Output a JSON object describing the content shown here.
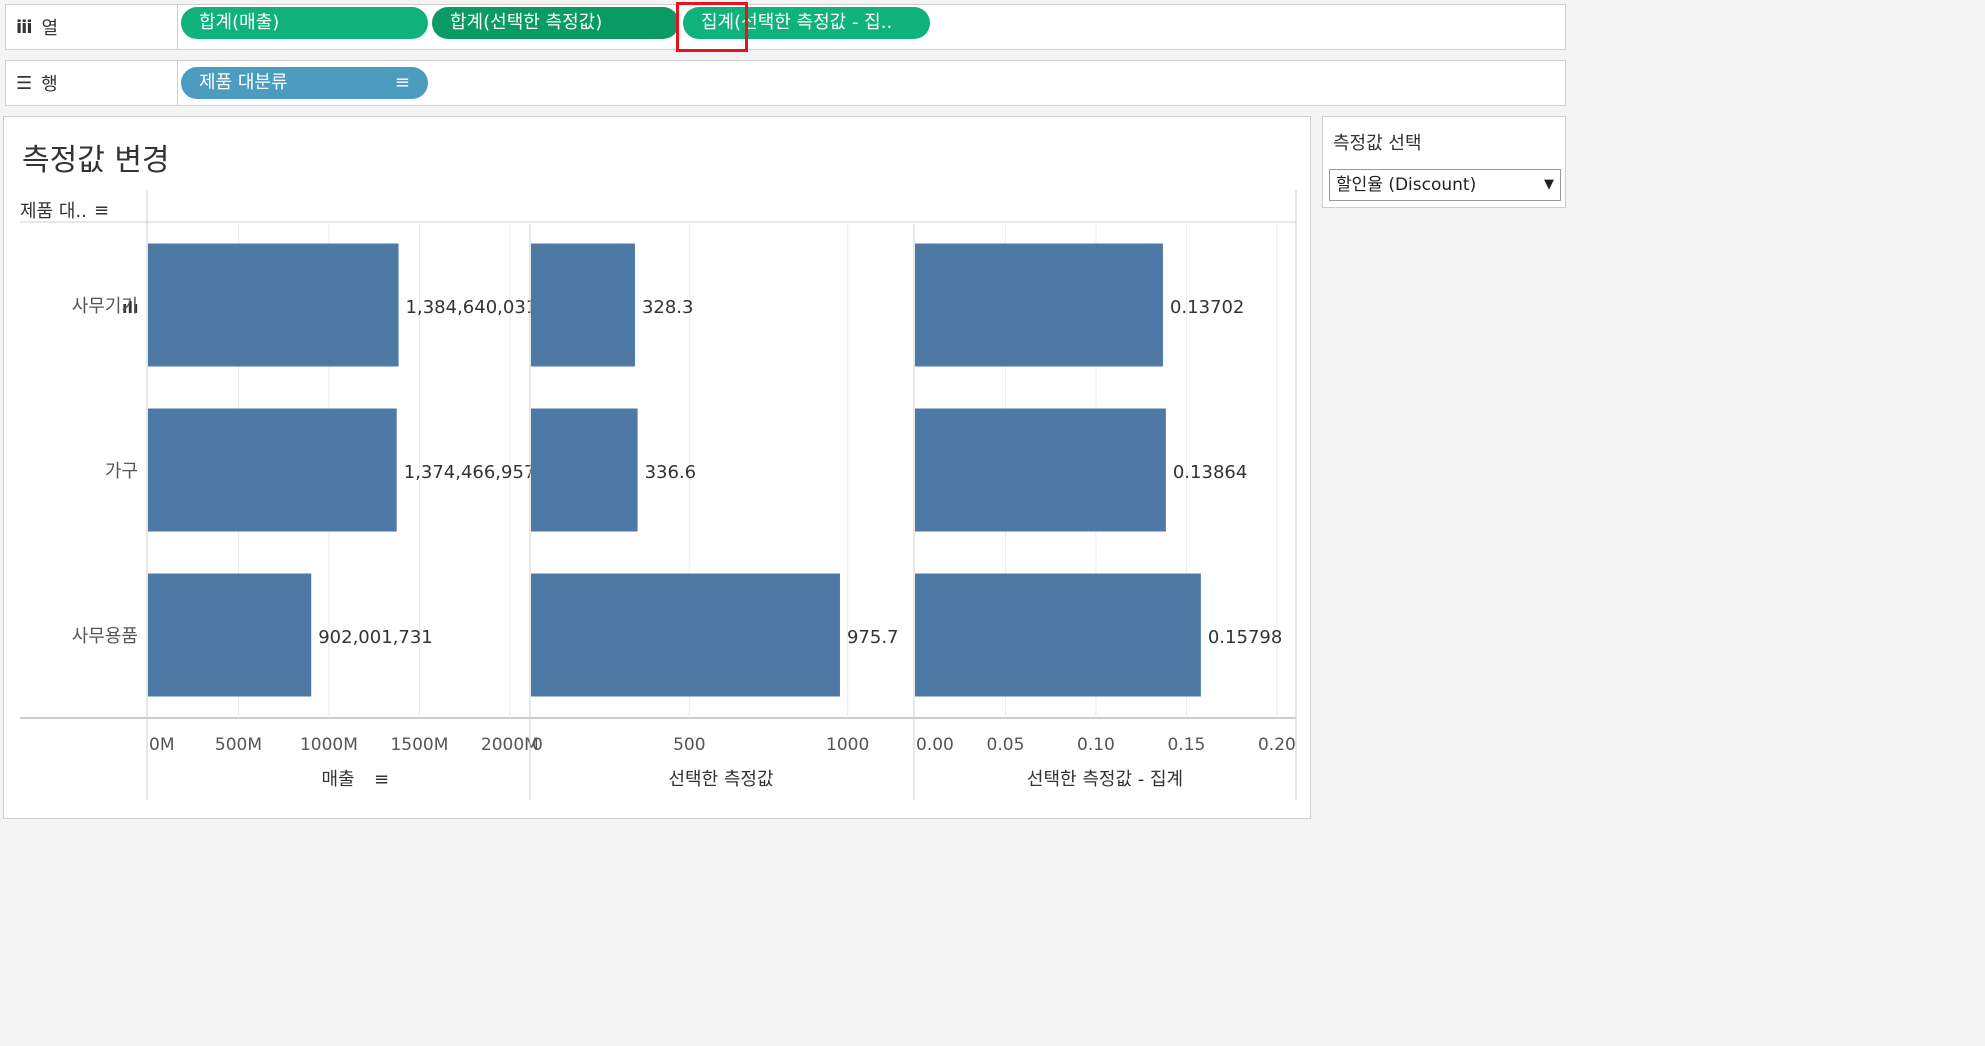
{
  "columns_shelf": {
    "label": "열",
    "pills": [
      "합계(매출)",
      "합계(선택한 측정값)",
      "집계(선택한 측정값 - 집.."
    ]
  },
  "rows_shelf": {
    "label": "행",
    "pills": [
      "제품 대분류"
    ]
  },
  "view": {
    "title": "측정값 변경",
    "row_header": "제품 대.."
  },
  "filter": {
    "title": "측정값 선택",
    "selected": "할인율 (Discount)"
  },
  "colors": {
    "bar": "#4e79a7",
    "pill_green": "#0fb27a",
    "pill_dark_green": "#0a9a65",
    "pill_blue": "#4c9cc0",
    "highlight": "#e8141b"
  },
  "chart_data": {
    "type": "bar",
    "orientation": "horizontal",
    "categories": [
      "사무기기",
      "가구",
      "사무용품"
    ],
    "panels": [
      {
        "axis_title": "매출",
        "values": [
          1384640031,
          1374466957,
          902001731
        ],
        "labels": [
          "1,384,640,031",
          "1,374,466,957",
          "902,001,731"
        ],
        "ticks": [
          0,
          500000000,
          1000000000,
          1500000000,
          2000000000
        ],
        "tick_labels": [
          "0M",
          "500M",
          "1000M",
          "1500M",
          "2000M"
        ],
        "xlim": [
          0,
          2100000000
        ]
      },
      {
        "axis_title": "선택한 측정값",
        "values": [
          328.3,
          336.6,
          975.7
        ],
        "labels": [
          "328.3",
          "336.6",
          "975.7"
        ],
        "ticks": [
          0,
          500,
          1000
        ],
        "tick_labels": [
          "0",
          "500",
          "1000"
        ],
        "xlim": [
          0,
          1200
        ]
      },
      {
        "axis_title": "선택한 측정값 - 집계",
        "values": [
          0.13702,
          0.13864,
          0.15798
        ],
        "labels": [
          "0.13702",
          "0.13864",
          "0.15798"
        ],
        "ticks": [
          0,
          0.05,
          0.1,
          0.15,
          0.2
        ],
        "tick_labels": [
          "0.00",
          "0.05",
          "0.10",
          "0.15",
          "0.20"
        ],
        "xlim": [
          0,
          0.21
        ]
      }
    ]
  }
}
